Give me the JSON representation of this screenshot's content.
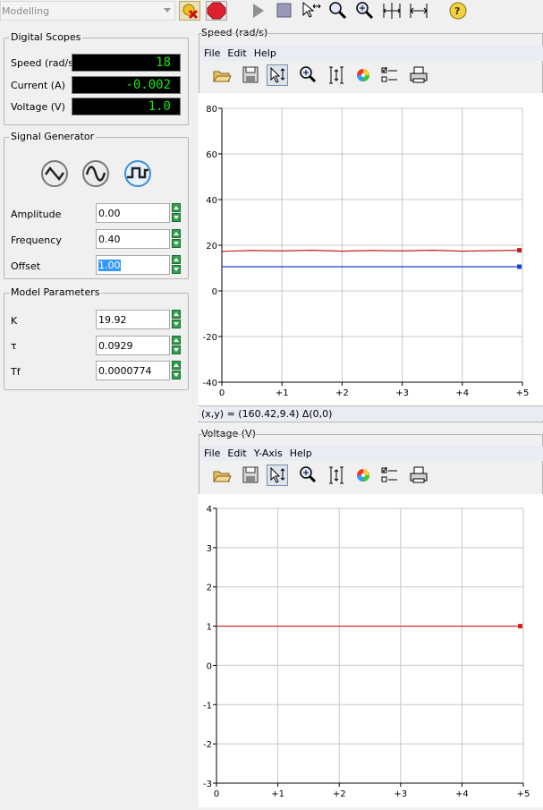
{
  "toolbar": {
    "mode_value": "Modelling",
    "icons": [
      "cancel-run-icon",
      "stop-icon",
      "play-icon",
      "square-icon",
      "select-move-icon",
      "zoom-icon",
      "zoom-in-icon",
      "fit-all-icon",
      "fit-horizontal-icon",
      "help-icon"
    ]
  },
  "digital_scopes": {
    "title": "Digital Scopes",
    "rows": [
      {
        "label": "Speed (rad/s)",
        "value": "18"
      },
      {
        "label": "Current (A)",
        "value": "-0.002"
      },
      {
        "label": "Voltage (V)",
        "value": "1.0"
      }
    ]
  },
  "signal_generator": {
    "title": "Signal Generator",
    "waveforms": [
      "triangle-wave-icon",
      "sine-wave-icon",
      "square-wave-icon"
    ],
    "fields": [
      {
        "label": "Amplitude",
        "value": "0.00"
      },
      {
        "label": "Frequency",
        "value": "0.40"
      },
      {
        "label": "Offset",
        "value": "1.00"
      }
    ]
  },
  "model_parameters": {
    "title": "Model Parameters",
    "fields": [
      {
        "label": "K",
        "value": "19.92"
      },
      {
        "label": "τ",
        "value": "0.0929"
      },
      {
        "label": "Tf",
        "value": "0.0000774"
      }
    ]
  },
  "speed_scope": {
    "title": "Speed (rad/s)",
    "menu": [
      "File",
      "Edit",
      "Help"
    ],
    "coord_readout": "(x,y) = (160.42,9.4) Δ(0,0)"
  },
  "voltage_scope": {
    "title": "Voltage (V)",
    "menu": [
      "File",
      "Edit",
      "Y-Axis",
      "Help"
    ]
  },
  "colors": {
    "lcd_text": "#19e619",
    "series_red": "#d42020",
    "series_blue": "#1f3fd6",
    "menu_bg": "#e9ecf3"
  },
  "chart_data": [
    {
      "type": "line",
      "title": "Speed (rad/s)",
      "xlim": [
        0,
        5
      ],
      "ylim": [
        -40,
        80
      ],
      "xticks": [
        "0",
        "+1",
        "+2",
        "+3",
        "+4",
        "+5"
      ],
      "yticks": [
        "-40",
        "-20",
        "0",
        "20",
        "40",
        "60",
        "80"
      ],
      "grid": true,
      "series": [
        {
          "color": "#c02020",
          "x": [
            0,
            0.5,
            1,
            1.5,
            2,
            2.5,
            3,
            3.5,
            4,
            4.5,
            4.95
          ],
          "values": [
            17.3,
            17.7,
            17.5,
            17.8,
            17.4,
            17.7,
            17.5,
            17.8,
            17.4,
            17.6,
            17.8
          ]
        },
        {
          "color": "#1f3fd6",
          "x": [
            0,
            4.95
          ],
          "values": [
            10.6,
            10.6
          ]
        }
      ]
    },
    {
      "type": "line",
      "title": "Voltage (V)",
      "xlim": [
        0,
        5
      ],
      "ylim": [
        -3,
        4
      ],
      "xticks": [
        "0",
        "+1",
        "+2",
        "+3",
        "+4",
        "+5"
      ],
      "yticks": [
        "-3",
        "-2",
        "-1",
        "0",
        "1",
        "2",
        "3",
        "4"
      ],
      "grid": true,
      "series": [
        {
          "color": "#d42020",
          "x": [
            0,
            4.95
          ],
          "values": [
            1.0,
            1.0
          ]
        }
      ]
    }
  ]
}
